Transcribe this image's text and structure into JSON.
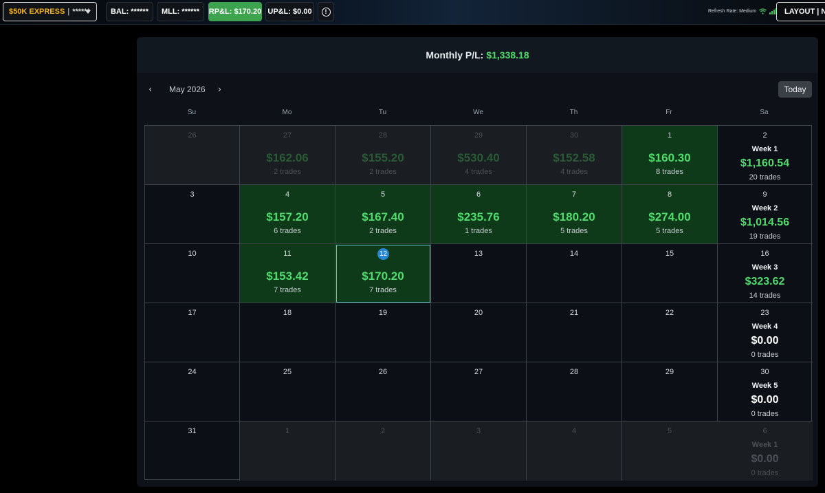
{
  "topbar": {
    "account_name": "$50K EXPRESS",
    "account_separator": "|",
    "account_mask": "******",
    "balance": "BAL: ******",
    "mll": "MLL: ******",
    "rpl": "RP&L: $170.20",
    "upl": "UP&L: $0.00",
    "info_glyph": "!",
    "refresh_rate": "Refresh Rate: Medium",
    "layout_label": "LAYOUT | NEW"
  },
  "calendar": {
    "header_label": "Monthly P/L:",
    "header_value": "$1,338.18",
    "month": "May 2026",
    "prev_glyph": "‹",
    "next_glyph": "›",
    "today_label": "Today",
    "weekdays": [
      "Su",
      "Mo",
      "Tu",
      "We",
      "Th",
      "Fr",
      "Sa"
    ],
    "weeks": [
      {
        "days": [
          {
            "day": "26",
            "kind": "other"
          },
          {
            "day": "27",
            "kind": "other",
            "amount": "$162.06",
            "trades": "2 trades"
          },
          {
            "day": "28",
            "kind": "other",
            "amount": "$155.20",
            "trades": "2 trades"
          },
          {
            "day": "29",
            "kind": "other",
            "amount": "$530.40",
            "trades": "4 trades"
          },
          {
            "day": "30",
            "kind": "other",
            "amount": "$152.58",
            "trades": "4 trades"
          },
          {
            "day": "1",
            "kind": "profit",
            "amount": "$160.30",
            "trades": "8 trades"
          }
        ],
        "summary": {
          "day": "2",
          "label": "Week 1",
          "amount": "$1,160.54",
          "trades": "20 trades"
        }
      },
      {
        "days": [
          {
            "day": "3",
            "kind": "empty"
          },
          {
            "day": "4",
            "kind": "profit",
            "amount": "$157.20",
            "trades": "6 trades"
          },
          {
            "day": "5",
            "kind": "profit",
            "amount": "$167.40",
            "trades": "2 trades"
          },
          {
            "day": "6",
            "kind": "profit",
            "amount": "$235.76",
            "trades": "1 trades"
          },
          {
            "day": "7",
            "kind": "profit",
            "amount": "$180.20",
            "trades": "5 trades"
          },
          {
            "day": "8",
            "kind": "profit",
            "amount": "$274.00",
            "trades": "5 trades"
          }
        ],
        "summary": {
          "day": "9",
          "label": "Week 2",
          "amount": "$1,014.56",
          "trades": "19 trades"
        }
      },
      {
        "days": [
          {
            "day": "10",
            "kind": "empty"
          },
          {
            "day": "11",
            "kind": "profit",
            "amount": "$153.42",
            "trades": "7 trades"
          },
          {
            "day": "12",
            "kind": "selected",
            "amount": "$170.20",
            "trades": "7 trades"
          },
          {
            "day": "13",
            "kind": "empty"
          },
          {
            "day": "14",
            "kind": "empty"
          },
          {
            "day": "15",
            "kind": "empty"
          }
        ],
        "summary": {
          "day": "16",
          "label": "Week 3",
          "amount": "$323.62",
          "trades": "14 trades"
        }
      },
      {
        "days": [
          {
            "day": "17",
            "kind": "empty"
          },
          {
            "day": "18",
            "kind": "empty"
          },
          {
            "day": "19",
            "kind": "empty"
          },
          {
            "day": "20",
            "kind": "empty"
          },
          {
            "day": "21",
            "kind": "empty"
          },
          {
            "day": "22",
            "kind": "empty"
          }
        ],
        "summary": {
          "day": "23",
          "label": "Week 4",
          "amount": "$0.00",
          "trades": "0 trades"
        }
      },
      {
        "days": [
          {
            "day": "24",
            "kind": "empty"
          },
          {
            "day": "25",
            "kind": "empty"
          },
          {
            "day": "26",
            "kind": "empty"
          },
          {
            "day": "27",
            "kind": "empty"
          },
          {
            "day": "28",
            "kind": "empty"
          },
          {
            "day": "29",
            "kind": "empty"
          }
        ],
        "summary": {
          "day": "30",
          "label": "Week 5",
          "amount": "$0.00",
          "trades": "0 trades"
        }
      },
      {
        "days": [
          {
            "day": "31",
            "kind": "empty"
          },
          {
            "day": "1",
            "kind": "other"
          },
          {
            "day": "2",
            "kind": "other"
          },
          {
            "day": "3",
            "kind": "other"
          },
          {
            "day": "4",
            "kind": "other"
          },
          {
            "day": "5",
            "kind": "other"
          }
        ],
        "summary": {
          "day": "6",
          "label": "Week 1",
          "amount": "$0.00",
          "trades": "0 trades",
          "kind": "other"
        }
      }
    ]
  },
  "colors": {
    "profit_text": "#4fdc6c",
    "profit_cell": "#0f3a1a",
    "accent_green": "#3ea34f",
    "account_name": "#f5b323",
    "selected_day": "#2587d1"
  },
  "icons": [
    "chevron-down-icon",
    "info-icon",
    "wifi-icon",
    "signal-bars-icon",
    "chevron-left-icon",
    "chevron-right-icon"
  ]
}
